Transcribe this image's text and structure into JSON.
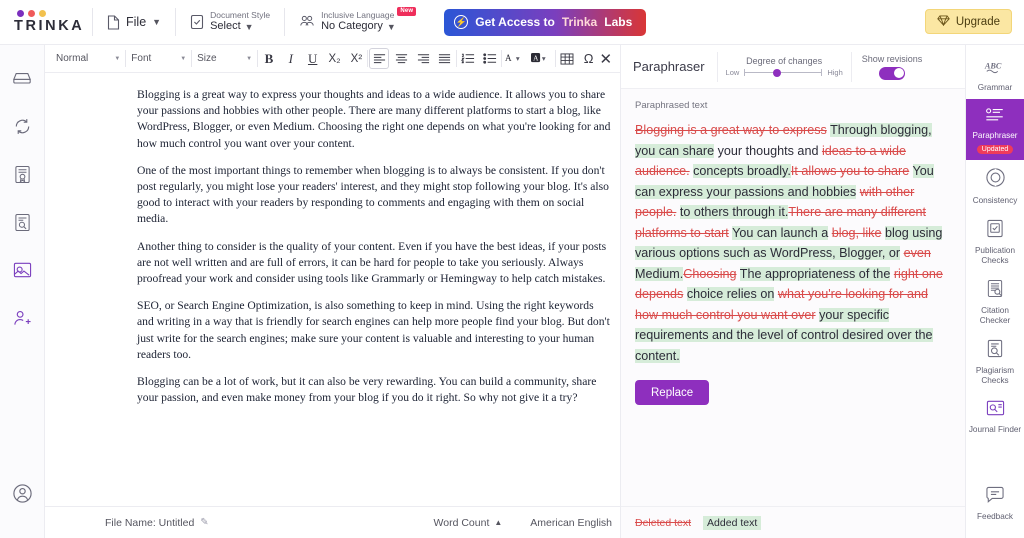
{
  "header": {
    "logo_text": "TRINKA",
    "logo_dot_colors": [
      "#7b2fbe",
      "#ef5a5a",
      "#f2c14e"
    ],
    "file_menu": "File",
    "doc_style": {
      "label": "Document Style",
      "value": "Select"
    },
    "inclusive": {
      "label": "Inclusive Language",
      "value": "No Category",
      "badge": "New"
    },
    "labs_button": {
      "text_main": "Get Access to ",
      "text_brand": "Trinka",
      "text_tail": " Labs"
    },
    "upgrade_button": "Upgrade"
  },
  "toolbar": {
    "style_select": "Normal",
    "font_select": "Font",
    "size_select": "Size",
    "bold": "B",
    "italic": "I",
    "underline": "U",
    "subscript": "X₂",
    "superscript": "X²",
    "align_left": "align-left",
    "align_center": "align-center",
    "align_right": "align-right",
    "align_justify": "align-justify",
    "numbered_list": "numbered-list",
    "bullet_list": "bullet-list",
    "text_color": "A",
    "highlight": "A",
    "table": "table",
    "omega": "Ω",
    "close": "✕"
  },
  "left_rail": {
    "items": [
      {
        "name": "drawer-icon"
      },
      {
        "name": "sync-icon"
      },
      {
        "name": "certificate-icon"
      },
      {
        "name": "review-icon"
      },
      {
        "name": "image-check-icon"
      },
      {
        "name": "add-user-icon"
      }
    ],
    "bottom": {
      "name": "account-icon"
    }
  },
  "document": {
    "paragraphs": [
      "Blogging is a great way to express your thoughts and ideas to a wide audience. It allows you to share your passions and hobbies with other people. There are many different platforms to start a blog, like WordPress, Blogger, or even Medium. Choosing the right one depends on what you're looking for and how much control you want over your content.",
      "One of the most important things to remember when blogging is to always be consistent. If you don't post regularly, you might lose your readers' interest, and they might stop following your blog. It's also good to interact with your readers by responding to comments and engaging with them on social media.",
      "Another thing to consider is the quality of your content. Even if you have the best ideas, if your posts are not well written and are full of errors, it can be hard for people to take you seriously. Always proofread your work and consider using tools like Grammarly or Hemingway to help catch mistakes.",
      "SEO, or Search Engine Optimization, is also something to keep in mind. Using the right keywords and writing in a way that is friendly for search engines can help more people find your blog. But don't just write for the search engines; make sure your content is valuable and interesting to your human readers too.",
      "Blogging can be a lot of work, but it can also be very rewarding. You can build a community, share your passion, and even make money from your blog if you do it right. So why not give it a try?"
    ]
  },
  "statusbar": {
    "file_name_label": "File Name: Untitled",
    "word_count": "Word Count",
    "language": "American English"
  },
  "paraphraser": {
    "title": "Paraphraser",
    "degree_label": "Degree of changes",
    "degree_low": "Low",
    "degree_high": "High",
    "show_revisions_label": "Show revisions",
    "show_revisions_on": true,
    "paraphrased_label": "Paraphrased text",
    "segments": [
      {
        "type": "del",
        "text": "Blogging is a great way to express"
      },
      {
        "type": "plain",
        "text": " "
      },
      {
        "type": "add",
        "text": "Through blogging, you can share"
      },
      {
        "type": "plain",
        "text": " your thoughts and "
      },
      {
        "type": "del",
        "text": "ideas to a wide audience."
      },
      {
        "type": "plain",
        "text": " "
      },
      {
        "type": "add",
        "text": "concepts broadly."
      },
      {
        "type": "del",
        "text": "It allows you to share"
      },
      {
        "type": "plain",
        "text": " "
      },
      {
        "type": "add",
        "text": "You can express your passions and hobbies"
      },
      {
        "type": "plain",
        "text": " "
      },
      {
        "type": "del",
        "text": "with other people."
      },
      {
        "type": "plain",
        "text": " "
      },
      {
        "type": "add",
        "text": "to others through it."
      },
      {
        "type": "del",
        "text": "There are many different platforms to start"
      },
      {
        "type": "plain",
        "text": " "
      },
      {
        "type": "add",
        "text": "You can launch a"
      },
      {
        "type": "plain",
        "text": " "
      },
      {
        "type": "del",
        "text": "blog, like"
      },
      {
        "type": "plain",
        "text": " "
      },
      {
        "type": "add",
        "text": "blog using various options such as WordPress, Blogger, or"
      },
      {
        "type": "plain",
        "text": " "
      },
      {
        "type": "del",
        "text": "even"
      },
      {
        "type": "plain",
        "text": " "
      },
      {
        "type": "add",
        "text": "Medium."
      },
      {
        "type": "del",
        "text": "Choosing"
      },
      {
        "type": "plain",
        "text": " "
      },
      {
        "type": "add",
        "text": "The appropriateness of the"
      },
      {
        "type": "plain",
        "text": " "
      },
      {
        "type": "del",
        "text": "right one depends"
      },
      {
        "type": "plain",
        "text": " "
      },
      {
        "type": "add",
        "text": "choice relies on"
      },
      {
        "type": "plain",
        "text": " "
      },
      {
        "type": "del",
        "text": "what you're looking for and how much control you want over"
      },
      {
        "type": "plain",
        "text": " "
      },
      {
        "type": "add",
        "text": "your specific requirements and the level of control desired over the"
      },
      {
        "type": "plain",
        "text": " "
      },
      {
        "type": "add",
        "text": "content."
      }
    ],
    "replace_button": "Replace",
    "legend_deleted": "Deleted text",
    "legend_added": "Added text"
  },
  "right_rail": {
    "items": [
      {
        "label": "Grammar",
        "icon": "abc-check-icon",
        "selected": false,
        "badge": ""
      },
      {
        "label": "Paraphraser",
        "icon": "paraphraser-icon",
        "selected": true,
        "badge": "Updated"
      },
      {
        "label": "Consistency",
        "icon": "consistency-icon",
        "selected": false,
        "badge": ""
      },
      {
        "label": "Publication Checks",
        "icon": "publication-checks-icon",
        "selected": false,
        "badge": ""
      },
      {
        "label": "Citation Checker",
        "icon": "citation-checker-icon",
        "selected": false,
        "badge": ""
      },
      {
        "label": "Plagiarism Checks",
        "icon": "plagiarism-checks-icon",
        "selected": false,
        "badge": ""
      },
      {
        "label": "Journal Finder",
        "icon": "journal-finder-icon",
        "selected": false,
        "badge": ""
      }
    ],
    "feedback": {
      "label": "Feedback",
      "icon": "feedback-icon"
    }
  },
  "colors": {
    "accent_purple": "#8e2fbe",
    "deleted_red": "#d94b4b",
    "added_green": "#d6ecd9",
    "badge_red": "#ef3b5b"
  }
}
